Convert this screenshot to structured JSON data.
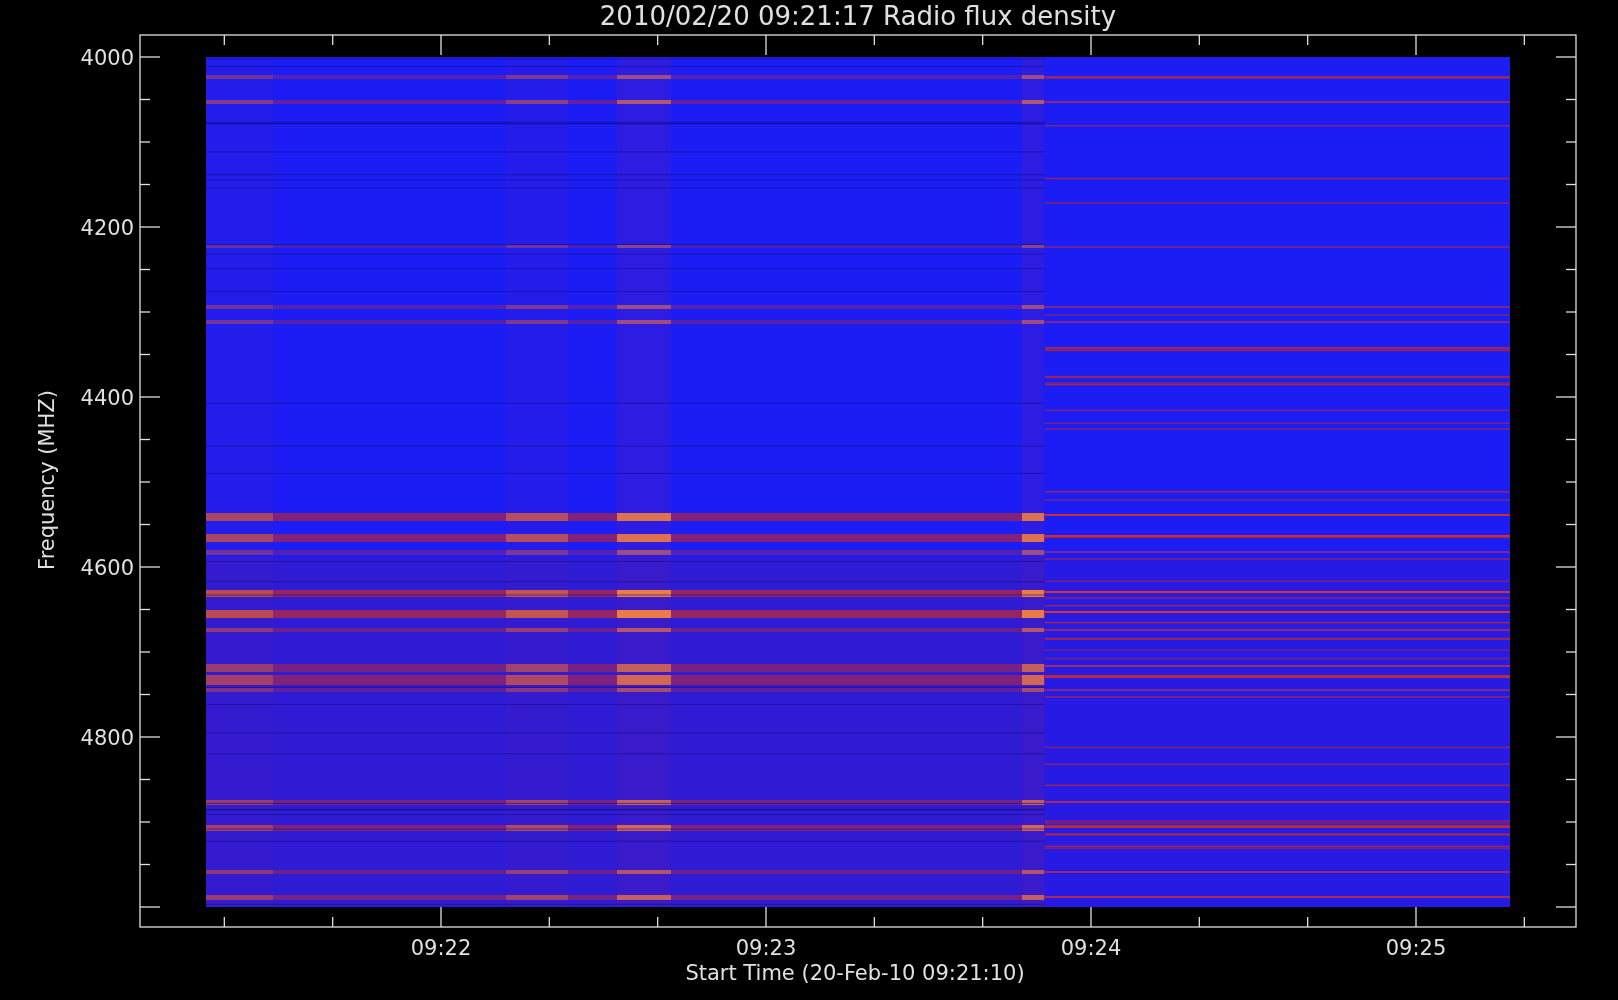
{
  "title": "2010/02/20 09:21:17 Radio flux density",
  "ylabel": "Frequency (MHZ)",
  "xlabel": "Start Time (20-Feb-10 09:21:10)",
  "yticks": [
    "4000",
    "4200",
    "4400",
    "4600",
    "4800"
  ],
  "xticks": [
    "09:22",
    "09:23",
    "09:24",
    "09:25"
  ]
}
